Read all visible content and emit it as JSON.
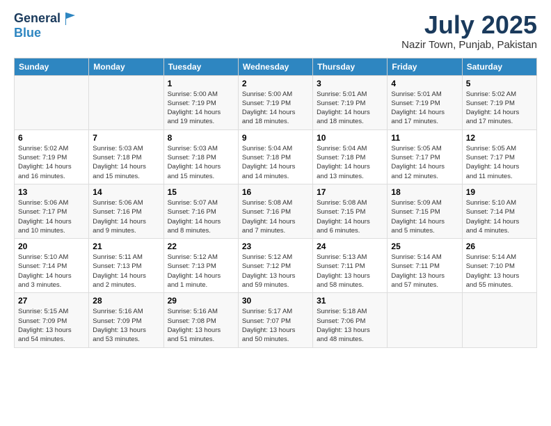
{
  "logo": {
    "line1": "General",
    "line2": "Blue"
  },
  "title": "July 2025",
  "subtitle": "Nazir Town, Punjab, Pakistan",
  "days_header": [
    "Sunday",
    "Monday",
    "Tuesday",
    "Wednesday",
    "Thursday",
    "Friday",
    "Saturday"
  ],
  "weeks": [
    [
      {
        "day": "",
        "info": ""
      },
      {
        "day": "",
        "info": ""
      },
      {
        "day": "1",
        "info": "Sunrise: 5:00 AM\nSunset: 7:19 PM\nDaylight: 14 hours\nand 19 minutes."
      },
      {
        "day": "2",
        "info": "Sunrise: 5:00 AM\nSunset: 7:19 PM\nDaylight: 14 hours\nand 18 minutes."
      },
      {
        "day": "3",
        "info": "Sunrise: 5:01 AM\nSunset: 7:19 PM\nDaylight: 14 hours\nand 18 minutes."
      },
      {
        "day": "4",
        "info": "Sunrise: 5:01 AM\nSunset: 7:19 PM\nDaylight: 14 hours\nand 17 minutes."
      },
      {
        "day": "5",
        "info": "Sunrise: 5:02 AM\nSunset: 7:19 PM\nDaylight: 14 hours\nand 17 minutes."
      }
    ],
    [
      {
        "day": "6",
        "info": "Sunrise: 5:02 AM\nSunset: 7:19 PM\nDaylight: 14 hours\nand 16 minutes."
      },
      {
        "day": "7",
        "info": "Sunrise: 5:03 AM\nSunset: 7:18 PM\nDaylight: 14 hours\nand 15 minutes."
      },
      {
        "day": "8",
        "info": "Sunrise: 5:03 AM\nSunset: 7:18 PM\nDaylight: 14 hours\nand 15 minutes."
      },
      {
        "day": "9",
        "info": "Sunrise: 5:04 AM\nSunset: 7:18 PM\nDaylight: 14 hours\nand 14 minutes."
      },
      {
        "day": "10",
        "info": "Sunrise: 5:04 AM\nSunset: 7:18 PM\nDaylight: 14 hours\nand 13 minutes."
      },
      {
        "day": "11",
        "info": "Sunrise: 5:05 AM\nSunset: 7:17 PM\nDaylight: 14 hours\nand 12 minutes."
      },
      {
        "day": "12",
        "info": "Sunrise: 5:05 AM\nSunset: 7:17 PM\nDaylight: 14 hours\nand 11 minutes."
      }
    ],
    [
      {
        "day": "13",
        "info": "Sunrise: 5:06 AM\nSunset: 7:17 PM\nDaylight: 14 hours\nand 10 minutes."
      },
      {
        "day": "14",
        "info": "Sunrise: 5:06 AM\nSunset: 7:16 PM\nDaylight: 14 hours\nand 9 minutes."
      },
      {
        "day": "15",
        "info": "Sunrise: 5:07 AM\nSunset: 7:16 PM\nDaylight: 14 hours\nand 8 minutes."
      },
      {
        "day": "16",
        "info": "Sunrise: 5:08 AM\nSunset: 7:16 PM\nDaylight: 14 hours\nand 7 minutes."
      },
      {
        "day": "17",
        "info": "Sunrise: 5:08 AM\nSunset: 7:15 PM\nDaylight: 14 hours\nand 6 minutes."
      },
      {
        "day": "18",
        "info": "Sunrise: 5:09 AM\nSunset: 7:15 PM\nDaylight: 14 hours\nand 5 minutes."
      },
      {
        "day": "19",
        "info": "Sunrise: 5:10 AM\nSunset: 7:14 PM\nDaylight: 14 hours\nand 4 minutes."
      }
    ],
    [
      {
        "day": "20",
        "info": "Sunrise: 5:10 AM\nSunset: 7:14 PM\nDaylight: 14 hours\nand 3 minutes."
      },
      {
        "day": "21",
        "info": "Sunrise: 5:11 AM\nSunset: 7:13 PM\nDaylight: 14 hours\nand 2 minutes."
      },
      {
        "day": "22",
        "info": "Sunrise: 5:12 AM\nSunset: 7:13 PM\nDaylight: 14 hours\nand 1 minute."
      },
      {
        "day": "23",
        "info": "Sunrise: 5:12 AM\nSunset: 7:12 PM\nDaylight: 13 hours\nand 59 minutes."
      },
      {
        "day": "24",
        "info": "Sunrise: 5:13 AM\nSunset: 7:11 PM\nDaylight: 13 hours\nand 58 minutes."
      },
      {
        "day": "25",
        "info": "Sunrise: 5:14 AM\nSunset: 7:11 PM\nDaylight: 13 hours\nand 57 minutes."
      },
      {
        "day": "26",
        "info": "Sunrise: 5:14 AM\nSunset: 7:10 PM\nDaylight: 13 hours\nand 55 minutes."
      }
    ],
    [
      {
        "day": "27",
        "info": "Sunrise: 5:15 AM\nSunset: 7:09 PM\nDaylight: 13 hours\nand 54 minutes."
      },
      {
        "day": "28",
        "info": "Sunrise: 5:16 AM\nSunset: 7:09 PM\nDaylight: 13 hours\nand 53 minutes."
      },
      {
        "day": "29",
        "info": "Sunrise: 5:16 AM\nSunset: 7:08 PM\nDaylight: 13 hours\nand 51 minutes."
      },
      {
        "day": "30",
        "info": "Sunrise: 5:17 AM\nSunset: 7:07 PM\nDaylight: 13 hours\nand 50 minutes."
      },
      {
        "day": "31",
        "info": "Sunrise: 5:18 AM\nSunset: 7:06 PM\nDaylight: 13 hours\nand 48 minutes."
      },
      {
        "day": "",
        "info": ""
      },
      {
        "day": "",
        "info": ""
      }
    ]
  ]
}
